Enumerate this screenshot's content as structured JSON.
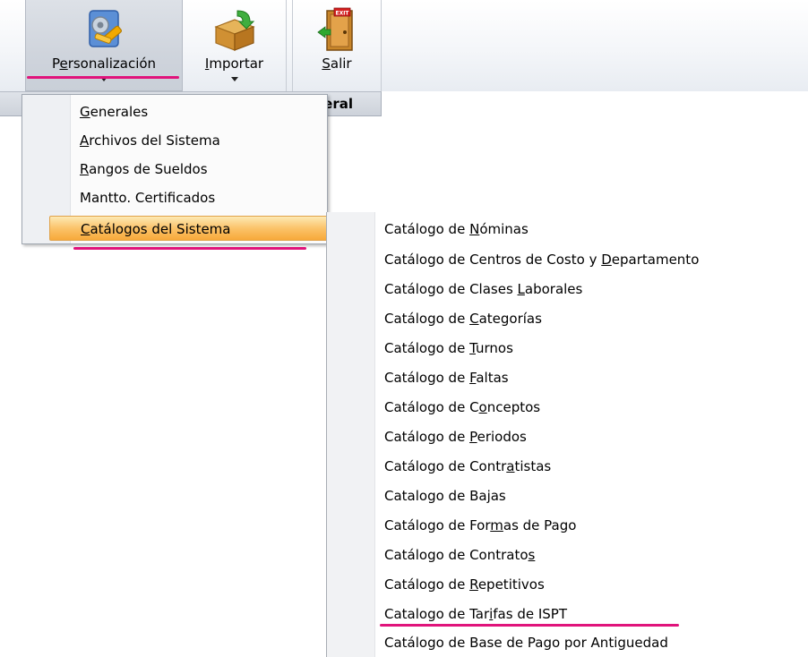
{
  "ribbon": {
    "buttons": [
      {
        "label_pre": "P",
        "label_u": "e",
        "label_post": "rsonalización",
        "icon": "gear-settings-icon"
      },
      {
        "label_pre": "",
        "label_u": "I",
        "label_post": "mportar",
        "icon": "box-import-icon"
      },
      {
        "label_pre": "",
        "label_u": "S",
        "label_post": "alir",
        "icon": "exit-door-icon"
      }
    ],
    "group_label": "General"
  },
  "menu": {
    "items": [
      {
        "pre": "",
        "u": "G",
        "post": "enerales"
      },
      {
        "pre": "",
        "u": "A",
        "post": "rchivos del Sistema"
      },
      {
        "pre": "",
        "u": "R",
        "post": "angos de Sueldos"
      },
      {
        "pre": "Mantto. Certificados",
        "u": "",
        "post": ""
      },
      {
        "pre": "",
        "u": "C",
        "post": "atálogos del Sistema"
      }
    ]
  },
  "submenu": {
    "items": [
      {
        "pre": "Catálogo de ",
        "u": "N",
        "post": "óminas"
      },
      {
        "pre": "Catálogo de Centros de Costo y ",
        "u": "D",
        "post": "epartamento"
      },
      {
        "pre": "Catálogo de Clases ",
        "u": "L",
        "post": "aborales"
      },
      {
        "pre": "Catálogo de ",
        "u": "C",
        "post": "ategorías"
      },
      {
        "pre": "Catálogo de ",
        "u": "T",
        "post": "urnos"
      },
      {
        "pre": "Catálogo de ",
        "u": "F",
        "post": "altas"
      },
      {
        "pre": "Catálogo de C",
        "u": "o",
        "post": "nceptos"
      },
      {
        "pre": "Catálogo de ",
        "u": "P",
        "post": "eriodos"
      },
      {
        "pre": "Catálogo de Contr",
        "u": "a",
        "post": "tistas"
      },
      {
        "pre": "Catalogo de Ba",
        "u": "j",
        "post": "as"
      },
      {
        "pre": "Catálogo de For",
        "u": "m",
        "post": "as de Pago"
      },
      {
        "pre": "Catálogo de Contrato",
        "u": "s",
        "post": ""
      },
      {
        "pre": "Catálogo de ",
        "u": "R",
        "post": "epetitivos"
      },
      {
        "pre": "Catalogo de Tar",
        "u": "i",
        "post": "fas de ISPT"
      },
      {
        "pre": "Catálogo de Base de Pago por Antiguedad",
        "u": "",
        "post": ""
      }
    ]
  },
  "colors": {
    "highlight_mark": "#e0137b",
    "menu_hover": "#fbc36a"
  }
}
